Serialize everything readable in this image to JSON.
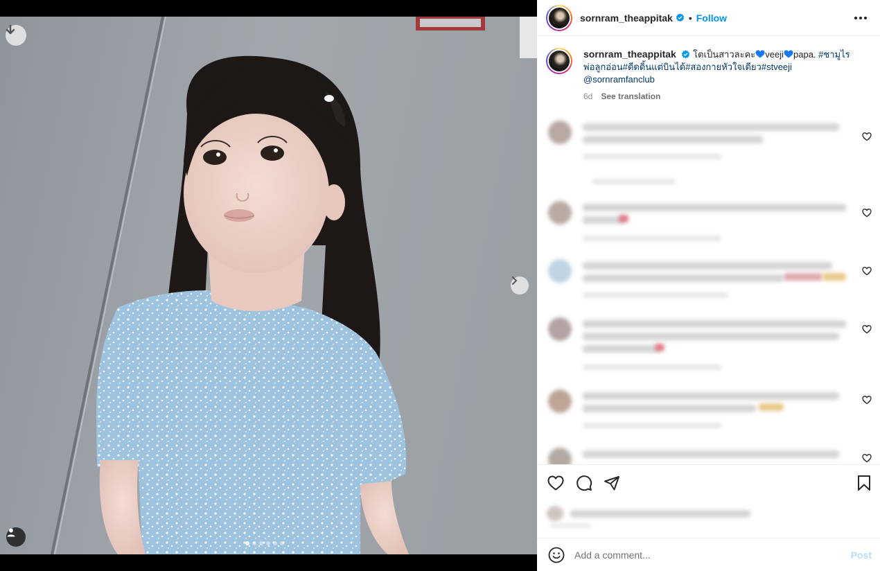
{
  "media": {
    "download_icon": "download-arrow-icon",
    "next_icon": "chevron-right-icon",
    "tagged_user_icon": "user-icon",
    "carousel_dots": 6,
    "active_dot": 0
  },
  "header": {
    "username": "sornram_theappitak",
    "verified": true,
    "separator": "•",
    "follow_label": "Follow",
    "more_icon": "more-horizontal-icon"
  },
  "caption": {
    "username": "sornram_theappitak",
    "text_1": "โตเป็นสาวละคะ",
    "text_2": "veeji",
    "text_3": "papa.",
    "tag_1": "#ชามูไร",
    "line2_tag_1": "พ่อลูกอ่อน",
    "tag_2": "#ดีดดิ้นแต่บินได้",
    "tag_3": "#สองกายหัวใจเดียว",
    "tag_4": "#stveeji",
    "mention": "@sornramfanclub",
    "time": "6d",
    "see_translation": "See translation"
  },
  "actions": {
    "like_icon": "heart-icon",
    "comment_icon": "comment-icon",
    "share_icon": "share-icon",
    "save_icon": "bookmark-icon"
  },
  "comment_box": {
    "emoji_icon": "smiley-icon",
    "placeholder": "Add a comment...",
    "post_label": "Post"
  },
  "colors": {
    "accent": "#0095f6",
    "tag": "#00376b",
    "post_disabled": "#b2dffc",
    "heart_emoji": "#1877f2"
  }
}
